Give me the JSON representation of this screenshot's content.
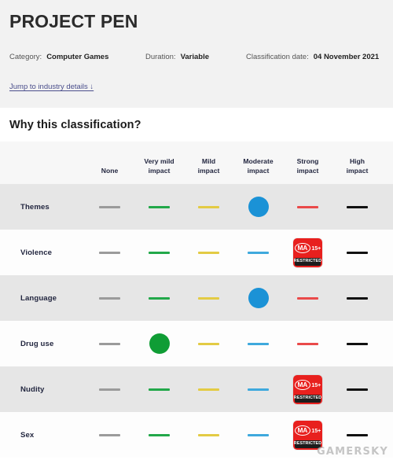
{
  "header": {
    "title": "PROJECT PEN",
    "meta": [
      {
        "label": "Category:",
        "value": "Computer Games"
      },
      {
        "label": "Duration:",
        "value": "Variable"
      },
      {
        "label": "Classification date:",
        "value": "04 November 2021"
      }
    ],
    "jump_link": "Jump to industry details ↓"
  },
  "section": {
    "heading": "Why this classification?"
  },
  "table": {
    "columns": [
      "None",
      "Very mild impact",
      "Mild impact",
      "Moderate impact",
      "Strong impact",
      "High impact"
    ],
    "columns_split": [
      {
        "line1": "None",
        "line2": ""
      },
      {
        "line1": "Very mild",
        "line2": "impact"
      },
      {
        "line1": "Mild",
        "line2": "impact"
      },
      {
        "line1": "Moderate",
        "line2": "impact"
      },
      {
        "line1": "Strong",
        "line2": "impact"
      },
      {
        "line1": "High",
        "line2": "impact"
      }
    ],
    "rows": [
      {
        "label": "Themes",
        "shade": "alt",
        "rating": "Moderate impact",
        "cells": [
          "dash-none",
          "dash-verymild",
          "dash-mild",
          "dot-moderate",
          "dash-strong",
          "dash-high"
        ]
      },
      {
        "label": "Violence",
        "shade": "plain",
        "rating": "Strong impact",
        "cells": [
          "dash-none",
          "dash-verymild",
          "dash-mild",
          "dash-moderate",
          "badge-ma15",
          "dash-high"
        ]
      },
      {
        "label": "Language",
        "shade": "alt",
        "rating": "Moderate impact",
        "cells": [
          "dash-none",
          "dash-verymild",
          "dash-mild",
          "dot-moderate",
          "dash-strong",
          "dash-high"
        ]
      },
      {
        "label": "Drug use",
        "shade": "plain",
        "rating": "Very mild impact",
        "cells": [
          "dash-none",
          "dot-verymild",
          "dash-mild",
          "dash-moderate",
          "dash-strong",
          "dash-high"
        ]
      },
      {
        "label": "Nudity",
        "shade": "alt",
        "rating": "Strong impact",
        "cells": [
          "dash-none",
          "dash-verymild",
          "dash-mild",
          "dash-moderate",
          "badge-ma15",
          "dash-high"
        ]
      },
      {
        "label": "Sex",
        "shade": "plain",
        "rating": "Strong impact",
        "cells": [
          "dash-none",
          "dash-verymild",
          "dash-mild",
          "dash-moderate",
          "badge-ma15",
          "dash-high"
        ]
      }
    ]
  },
  "badge": {
    "rating_code": "MA",
    "age": "15+",
    "restriction": "RESTRICTED"
  },
  "watermark": {
    "text": "GAMERSKY"
  },
  "colors": {
    "banner_bg": "#f2f2f2",
    "row_alt_bg": "#e6e6e6",
    "row_plain_bg": "#fdfdfd",
    "header_bg": "#f7f7f7",
    "none": "#9b9b9b",
    "very_mild": "#22a84a",
    "mild": "#e3cb44",
    "moderate": "#3fa9dd",
    "strong": "#ea4a4a",
    "high": "#111111",
    "dot_very_mild": "#0f9d35",
    "dot_moderate": "#1b92d6",
    "badge_red": "#e8201e",
    "link": "#4b4f8c"
  }
}
